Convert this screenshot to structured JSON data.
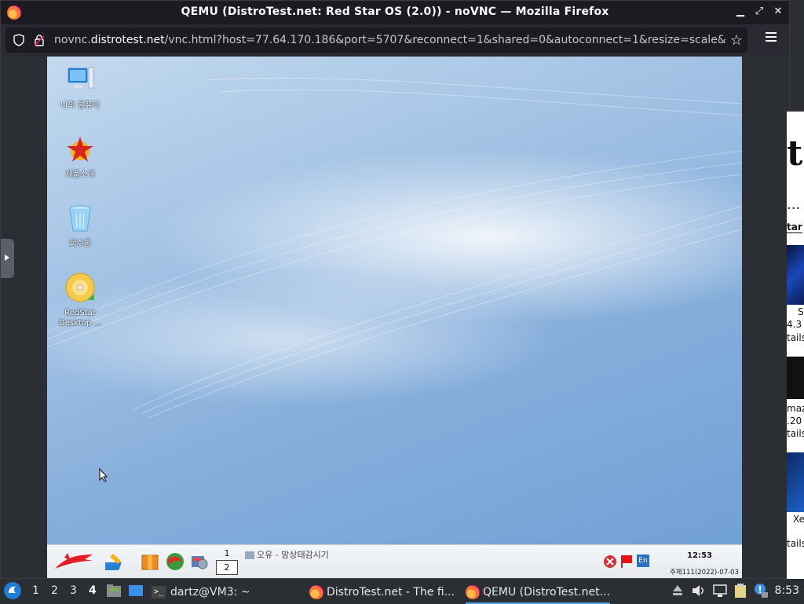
{
  "window": {
    "title": "QEMU (DistroTest.net: Red Star OS (2.0)) - noVNC — Mozilla Firefox",
    "minimize_glyph": "▁",
    "maximize_glyph": "⤢",
    "close_glyph": "✕"
  },
  "urlbar": {
    "prefix": "novnc.",
    "domain": "distrotest.net",
    "path": "/vnc.html?host=77.64.170.186&port=5707&reconnect=1&shared=0&autoconnect=1&resize=scale&"
  },
  "desktop_icons": [
    {
      "label": "나의 콤퓨터",
      "icon": "computer-icon"
    },
    {
      "label": "제품소개",
      "icon": "redstar-logo-icon"
    },
    {
      "label": "회수통",
      "icon": "recycle-bin-icon"
    },
    {
      "label": "RedStar Desktop ...",
      "icon": "dvd-disc-icon"
    }
  ],
  "qemu_taskbar": {
    "pager": [
      "1",
      "2"
    ],
    "current_desktop": "2",
    "task": "오유 - 망상태감시기",
    "clock": "12:53",
    "date": "주체111(2022)-07-03",
    "lang": "En"
  },
  "right_page": {
    "snippets": [
      "t",
      "...",
      "tar",
      "S",
      "4.3",
      "tails",
      "maz",
      ".20",
      "tails",
      "Xe",
      "tails"
    ]
  },
  "panel": {
    "workspaces": [
      "1",
      "2",
      "3",
      "4"
    ],
    "active_workspace": "4",
    "tasks": [
      {
        "label": "dartz@VM3: ~",
        "icon": "terminal-icon"
      },
      {
        "label": "DistroTest.net - The fi...",
        "icon": "firefox-icon"
      },
      {
        "label": "QEMU (DistroTest.net...",
        "icon": "firefox-icon"
      }
    ],
    "clock": "8:53"
  }
}
